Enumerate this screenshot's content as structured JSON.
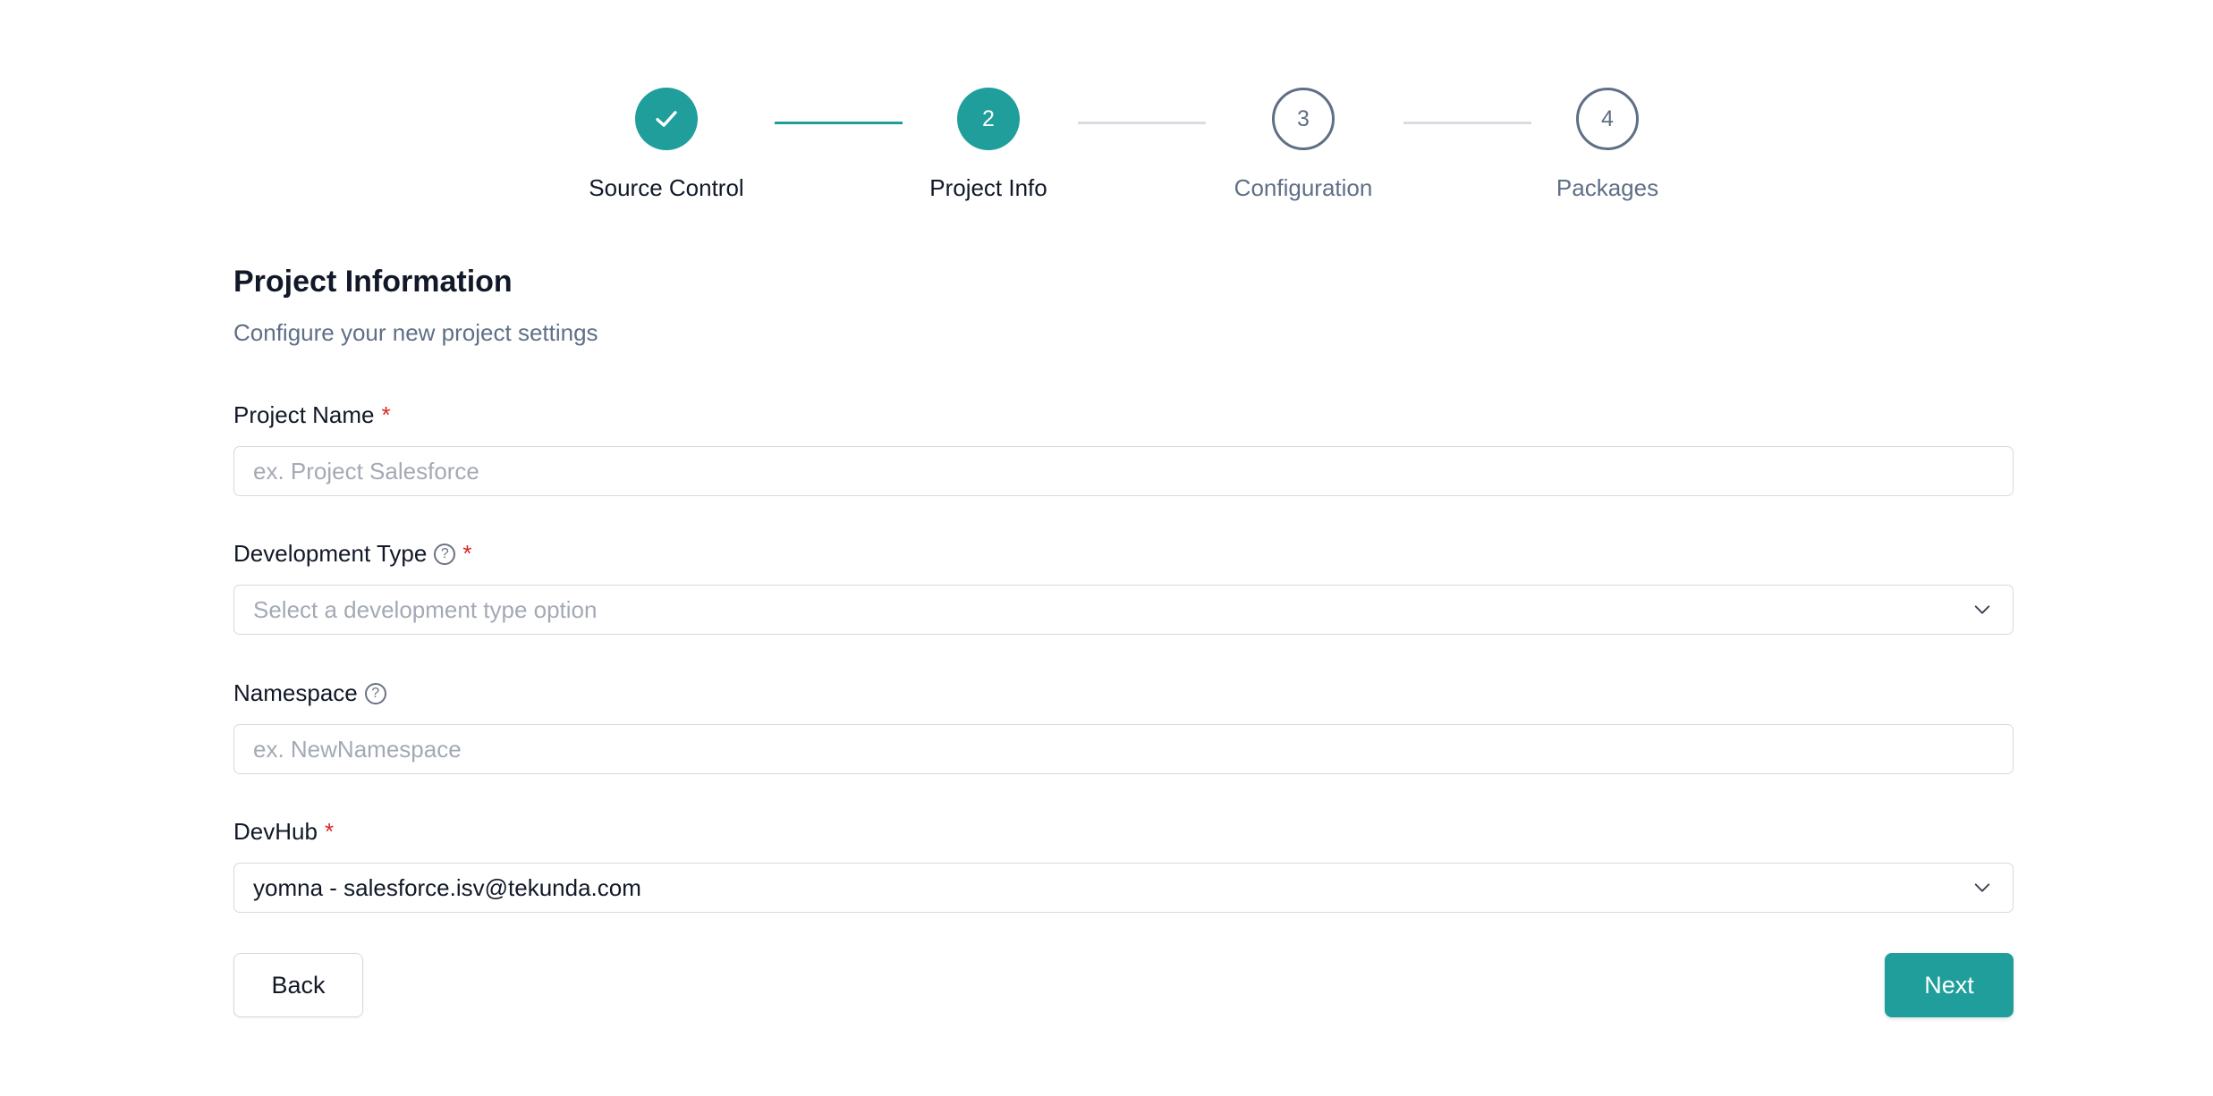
{
  "stepper": {
    "steps": [
      {
        "number": "",
        "label": "Source Control",
        "state": "done"
      },
      {
        "number": "2",
        "label": "Project Info",
        "state": "current"
      },
      {
        "number": "3",
        "label": "Configuration",
        "state": "upcoming"
      },
      {
        "number": "4",
        "label": "Packages",
        "state": "upcoming"
      }
    ]
  },
  "form": {
    "title": "Project Information",
    "subtitle": "Configure your new project settings",
    "required_mark": "*",
    "fields": {
      "project_name": {
        "label": "Project Name",
        "placeholder": "ex. Project Salesforce",
        "value": ""
      },
      "development_type": {
        "label": "Development Type",
        "placeholder": "Select a development type option"
      },
      "namespace": {
        "label": "Namespace",
        "placeholder": "ex. NewNamespace",
        "value": ""
      },
      "devhub": {
        "label": "DevHub",
        "value": "yomna - salesforce.isv@tekunda.com"
      }
    },
    "help_icon_glyph": "?"
  },
  "actions": {
    "back_label": "Back",
    "next_label": "Next"
  },
  "colors": {
    "accent": "#1f9e9c",
    "muted": "#5f6f86",
    "required": "#dc2626"
  },
  "icons": {
    "done_step": "check-icon",
    "help": "question-circle-icon",
    "dropdown": "chevron-down-icon"
  }
}
